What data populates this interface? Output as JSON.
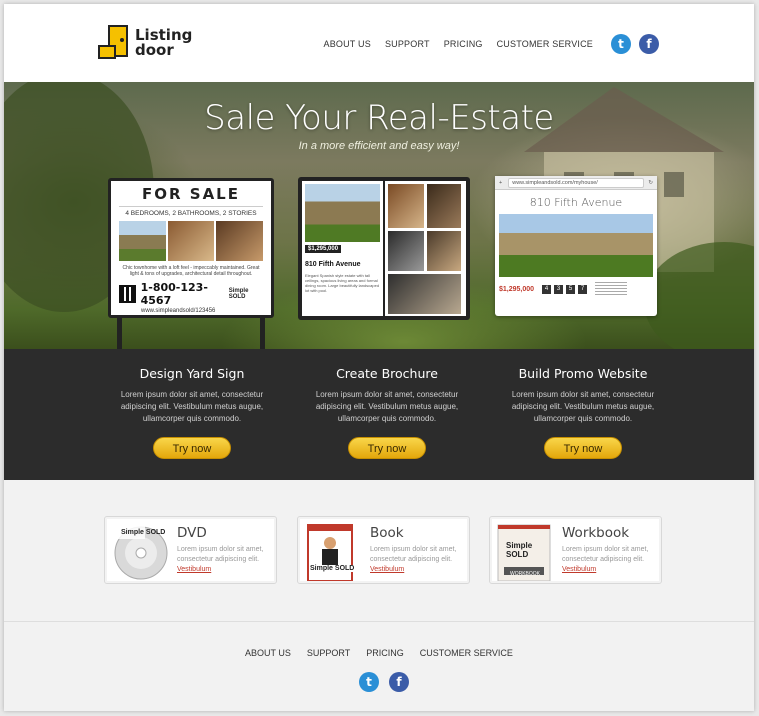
{
  "header": {
    "logo_text_1": "Listing",
    "logo_text_2": "door",
    "nav": [
      "ABOUT US",
      "SUPPORT",
      "PRICING",
      "CUSTOMER SERVICE"
    ]
  },
  "hero": {
    "title": "Sale Your Real-Estate",
    "subtitle": "In a more efficient and easy way!",
    "sign": {
      "title": "FOR SALE",
      "rooms": "4 BEDROOMS, 2 BATHROOMS, 2 STORIES",
      "desc": "Chic townhome with a loft feel - impeccably maintained. Great light & tons of upgrades, architectural detail throughout.",
      "phone": "1-800-123-4567",
      "url": "www.simpleandsold/123456",
      "brand": "Simple SOLD"
    },
    "brochure": {
      "price": "$1,295,000",
      "address": "810 Fifth Avenue",
      "text": "Elegant Spanish style estate with tall ceilings, spacious living areas and formal dining room. Large beautifully landscaped lot with pool."
    },
    "website": {
      "url": "www.simpleandsold.com/myhouse/",
      "address": "810 Fifth Avenue",
      "price": "$1,295,000",
      "stats": [
        "4",
        "3",
        "5",
        "7"
      ]
    }
  },
  "features": [
    {
      "title": "Design Yard Sign",
      "text": "Lorem ipsum dolor sit amet, consectetur adipiscing elit. Vestibulum metus augue, ullamcorper quis commodo.",
      "button": "Try now"
    },
    {
      "title": "Create Brochure",
      "text": "Lorem ipsum dolor sit amet, consectetur adipiscing elit. Vestibulum metus augue, ullamcorper quis commodo.",
      "button": "Try now"
    },
    {
      "title": "Build Promo Website",
      "text": "Lorem ipsum dolor sit amet, consectetur adipiscing elit. Vestibulum metus augue, ullamcorper quis commodo.",
      "button": "Try now"
    }
  ],
  "products": [
    {
      "name": "DVD",
      "text": "Lorem ipsum dolor sit amet, consectetur adipiscing elit.",
      "link": "Vestibulum",
      "thumb_label": "Simple SOLD"
    },
    {
      "name": "Book",
      "text": "Lorem ipsum dolor sit amet, consectetur adipiscing elit.",
      "link": "Vestibulum",
      "thumb_label": "Simple SOLD"
    },
    {
      "name": "Workbook",
      "text": "Lorem ipsum dolor sit amet, consectetur adipiscing elit.",
      "link": "Vestibulum",
      "thumb_label": "Simple SOLD",
      "thumb_caption": "WORKBOOK"
    }
  ],
  "footer": {
    "nav": [
      "ABOUT US",
      "SUPPORT",
      "PRICING",
      "CUSTOMER SERVICE"
    ]
  },
  "social": {
    "twitter_glyph": "t",
    "facebook_glyph": "f"
  },
  "colors": {
    "accent": "#f2c230",
    "band": "#2c2c2c",
    "twitter": "#2a8fd6",
    "facebook": "#3b5ca8",
    "logo_yellow": "#f5c000"
  }
}
